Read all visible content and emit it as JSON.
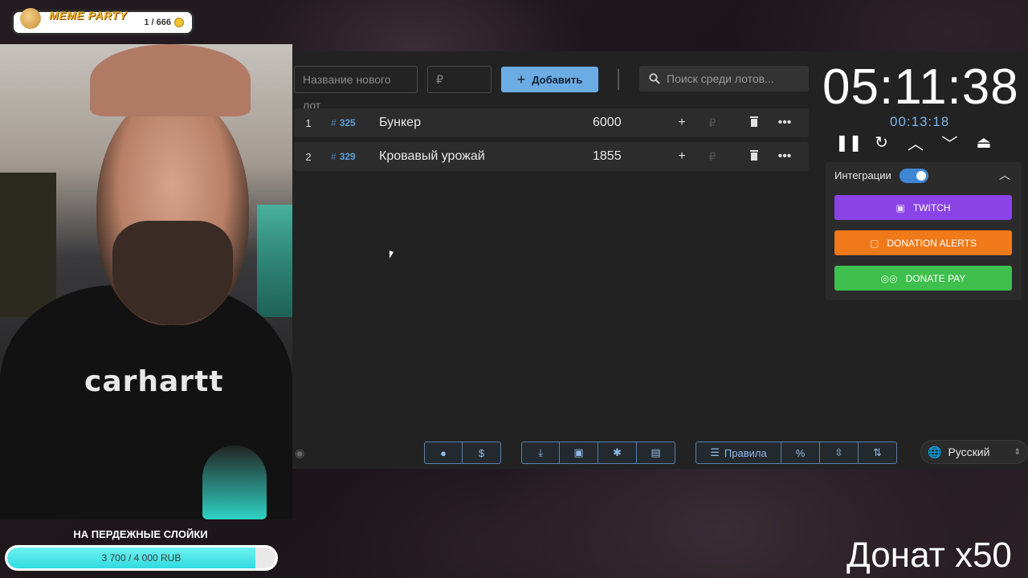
{
  "banner": {
    "title": "MEME PARTY",
    "count": "1 / 666"
  },
  "goal": {
    "title": "НА ПЕРДЕЖНЫЕ СЛОЙКИ",
    "text": "3 700 / 4 000 RUB",
    "progress": 0.925
  },
  "webcam": {
    "shirt_text": "carhartt"
  },
  "toolbar": {
    "name_placeholder": "Название нового лот",
    "amount_placeholder": "₽",
    "add_label": "Добавить",
    "search_placeholder": "Поиск среди лотов..."
  },
  "lots": [
    {
      "index": "1",
      "id": "325",
      "name": "Бункер",
      "amount": "6000"
    },
    {
      "index": "2",
      "id": "329",
      "name": "Кровавый урожай",
      "amount": "1855"
    }
  ],
  "bottom": {
    "rules_label": "Правила",
    "language": "Русский"
  },
  "timer": {
    "main": "05:11:38",
    "sub": "00:13:18"
  },
  "integrations": {
    "title": "Интеграции",
    "enabled": true,
    "twitch": "TWITCH",
    "donation_alerts": "DONATION ALERTS",
    "donate_pay": "DONATE PAY"
  },
  "overlay": {
    "donat_text": "Донат x50"
  },
  "colors": {
    "accent": "#6cace4",
    "twitch": "#8a44e6",
    "donation_alerts": "#f0791a",
    "donate_pay": "#3fbf4d",
    "goal_fill": "#30dbe0"
  },
  "icons": [
    "search-icon",
    "plus-icon",
    "trash-icon",
    "more-icon",
    "github-icon",
    "dollar-icon",
    "download-icon",
    "save-icon",
    "bug-icon",
    "clear-icon",
    "percent-icon",
    "compress-icon",
    "sort-icon",
    "eye-icon",
    "globe-icon",
    "pause-icon",
    "restart-icon",
    "chevron-up-icon",
    "chevron-down-icon",
    "eject-icon"
  ]
}
